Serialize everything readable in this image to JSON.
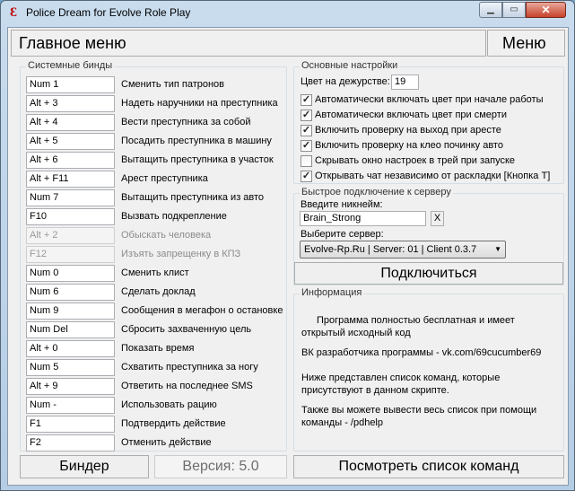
{
  "window": {
    "title": "Police Dream for Evolve Role Play",
    "icon_glyph": "Ɛ",
    "min_glyph": "▁",
    "max_glyph": "▭",
    "close_glyph": "✕"
  },
  "header": {
    "main_title": "Главное меню",
    "menu_label": "Меню"
  },
  "binds": {
    "group_label": "Системные бинды",
    "items": [
      {
        "key": "Num 1",
        "label": "Сменить тип патронов",
        "enabled": true
      },
      {
        "key": "Alt + 3",
        "label": "Надеть наручники на преступника",
        "enabled": true
      },
      {
        "key": "Alt + 4",
        "label": "Вести преступника за собой",
        "enabled": true
      },
      {
        "key": "Alt + 5",
        "label": "Посадить преступника в машину",
        "enabled": true
      },
      {
        "key": "Alt + 6",
        "label": "Вытащить преступника в участок",
        "enabled": true
      },
      {
        "key": "Alt + F11",
        "label": "Арест преступника",
        "enabled": true
      },
      {
        "key": "Num 7",
        "label": "Вытащить преступника из авто",
        "enabled": true
      },
      {
        "key": "F10",
        "label": "Вызвать подкрепление",
        "enabled": true
      },
      {
        "key": "Alt + 2",
        "label": "Обыскать человека",
        "enabled": false
      },
      {
        "key": "F12",
        "label": "Изъять запрещенку в КПЗ",
        "enabled": false
      },
      {
        "key": "Num 0",
        "label": "Сменить клист",
        "enabled": true
      },
      {
        "key": "Num 6",
        "label": "Сделать доклад",
        "enabled": true
      },
      {
        "key": "Num 9",
        "label": "Сообщения в мегафон о остановке",
        "enabled": true
      },
      {
        "key": "Num Del",
        "label": "Сбросить захваченную цель",
        "enabled": true
      },
      {
        "key": "Alt + 0",
        "label": "Показать время",
        "enabled": true
      },
      {
        "key": "Num 5",
        "label": "Схватить преступника за ногу",
        "enabled": true
      },
      {
        "key": "Alt + 9",
        "label": "Ответить на последнее SMS",
        "enabled": true
      },
      {
        "key": "Num -",
        "label": "Использовать рацию",
        "enabled": true
      },
      {
        "key": "F1",
        "label": "Подтвердить действие",
        "enabled": true
      },
      {
        "key": "F2",
        "label": "Отменить действие",
        "enabled": true
      }
    ]
  },
  "settings": {
    "group_label": "Основные настройки",
    "duty_color_label": "Цвет на дежурстве:",
    "duty_color_value": "19",
    "checks": [
      {
        "label": "Автоматически включать цвет при начале работы",
        "checked": true
      },
      {
        "label": "Автоматически включать цвет при смерти",
        "checked": true
      },
      {
        "label": "Включить проверку на выход при аресте",
        "checked": true
      },
      {
        "label": "Включить проверку на клео починку авто",
        "checked": true
      },
      {
        "label": "Скрывать окно настроек в трей при запуске",
        "checked": false
      },
      {
        "label": "Открывать чат независимо от раскладки [Кнопка T]",
        "checked": true
      }
    ]
  },
  "connect": {
    "group_label": "Быстрое подключение к серверу",
    "nick_label": "Введите никнейм:",
    "nick_value": "Brain_Strong",
    "clear_label": "X",
    "server_label": "Выберите сервер:",
    "server_value": "Evolve-Rp.Ru | Server: 01 | Client 0.3.7",
    "connect_label": "Подключиться"
  },
  "info": {
    "group_label": "Информация",
    "p1": "Программа полностью бесплатная и имеет открытый исходный код",
    "p2": "ВК разработчика программы - vk.com/69cucumber69",
    "p3": "Ниже представлен список команд, которые присутствуют в данном скрипте.",
    "p4": "Также вы можете вывести весь список при помощи команды - /pdhelp"
  },
  "bottom": {
    "binder_label": "Биндер",
    "version_label": "Версия: 5.0",
    "commands_label": "Посмотреть список команд"
  }
}
